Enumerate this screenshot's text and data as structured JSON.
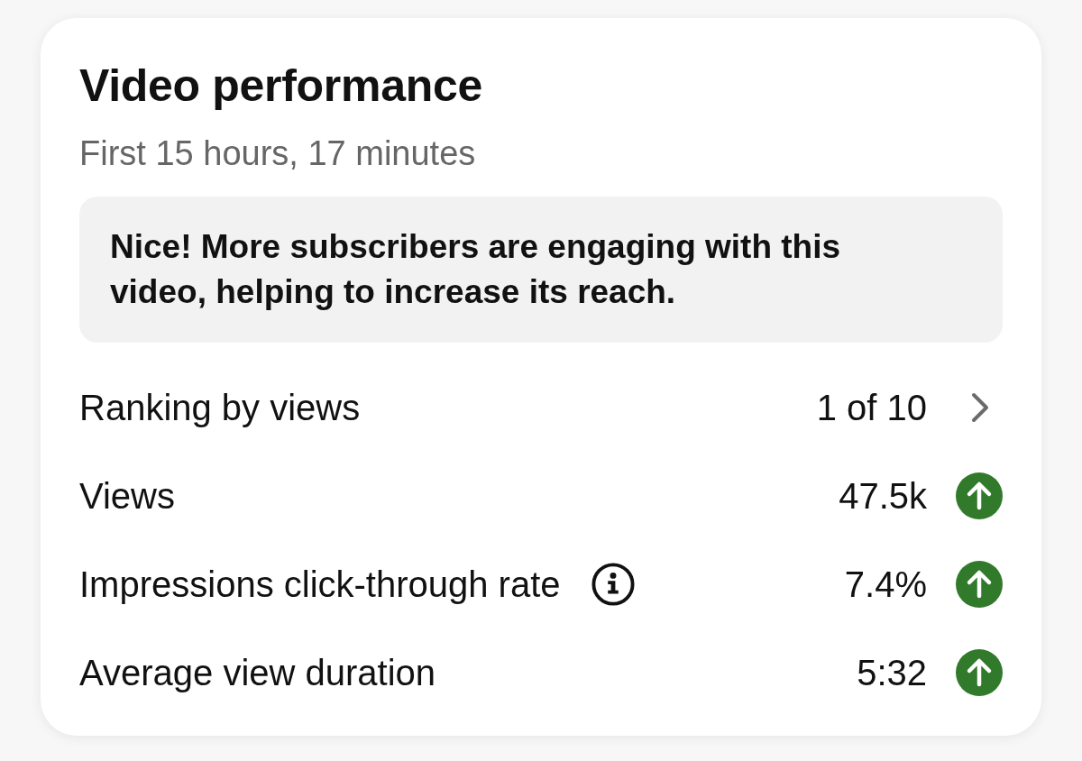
{
  "card": {
    "title": "Video performance",
    "subtitle": "First 15 hours, 17 minutes",
    "callout": "Nice! More subscribers are engaging with this video, helping to increase its reach.",
    "rows": [
      {
        "kind": "link",
        "label": "Ranking by views",
        "info": false,
        "value": "1 of 10"
      },
      {
        "kind": "metric",
        "label": "Views",
        "info": false,
        "value": "47.5k",
        "increased": true
      },
      {
        "kind": "metric",
        "label": "Impressions click-through rate",
        "info": true,
        "value": "7.4%",
        "increased": true
      },
      {
        "kind": "metric",
        "label": "Average view duration",
        "info": false,
        "value": "5:32",
        "increased": true
      }
    ]
  }
}
